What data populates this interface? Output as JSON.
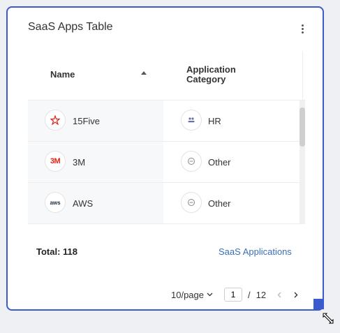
{
  "widget": {
    "title": "SaaS Apps Table",
    "menu_icon": "more-vertical-icon"
  },
  "table": {
    "columns": [
      "Name",
      "Application Category"
    ],
    "sort_icon": "sort-ascending-icon",
    "rows": [
      {
        "name": "15Five",
        "logo_icon": "15five-logo-icon",
        "category": "HR",
        "category_icon": "people-icon"
      },
      {
        "name": "3M",
        "logo_text": "3M",
        "category": "Other",
        "category_icon": "minus-circle-icon"
      },
      {
        "name": "AWS",
        "logo_text": "aws",
        "category": "Other",
        "category_icon": "minus-circle-icon"
      }
    ]
  },
  "footer": {
    "total_label": "Total: 118",
    "link_label": "SaaS Applications"
  },
  "pagination": {
    "page_size_label": "10/page",
    "current_page": "1",
    "separator": "/",
    "total_pages": "12",
    "prev_icon": "chevron-left-icon",
    "next_icon": "chevron-right-icon"
  },
  "colors": {
    "accent": "#3a5bd0",
    "link": "#3a6fb8",
    "logo_3m": "#e1251b"
  }
}
